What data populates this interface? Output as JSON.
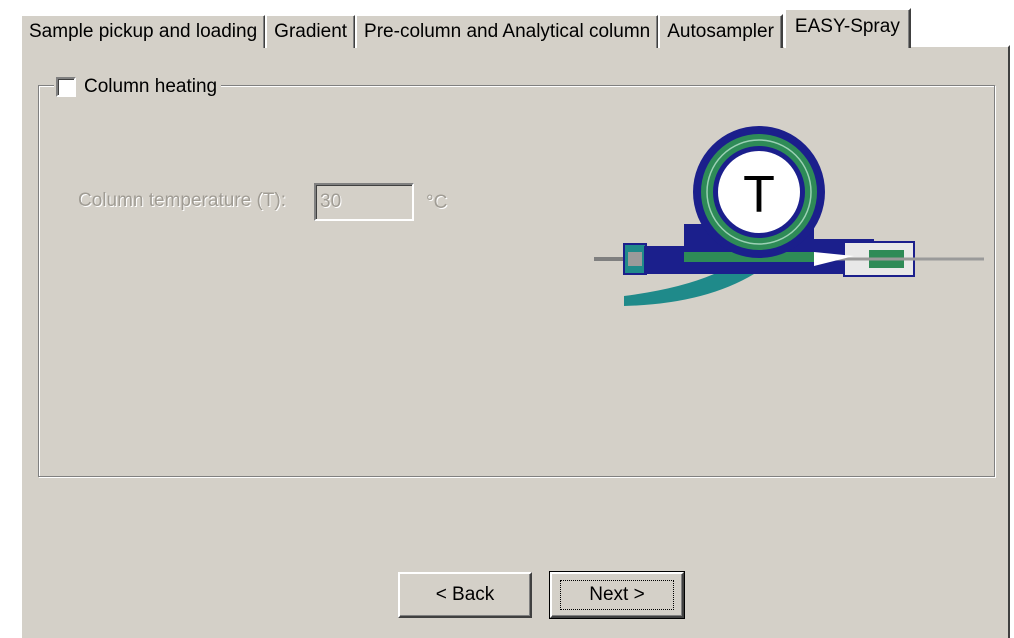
{
  "tabs": [
    {
      "label": "Sample pickup and loading",
      "active": false
    },
    {
      "label": "Gradient",
      "active": false
    },
    {
      "label": "Pre-column and Analytical column",
      "active": false
    },
    {
      "label": "Autosampler",
      "active": false
    },
    {
      "label": "EASY-Spray",
      "active": true
    }
  ],
  "group": {
    "checkbox_label": "Column heating",
    "checked": false
  },
  "temperature": {
    "label": "Column temperature (T):",
    "value": "30",
    "unit": "°C",
    "enabled": false
  },
  "illustration": {
    "letter": "T",
    "icon": "easy-spray-column-diagram",
    "colors": {
      "navy": "#1b1f8c",
      "green": "#2e8b57",
      "teal": "#1f8a8a"
    }
  },
  "buttons": {
    "back_label": "< Back",
    "next_label": "Next >"
  }
}
